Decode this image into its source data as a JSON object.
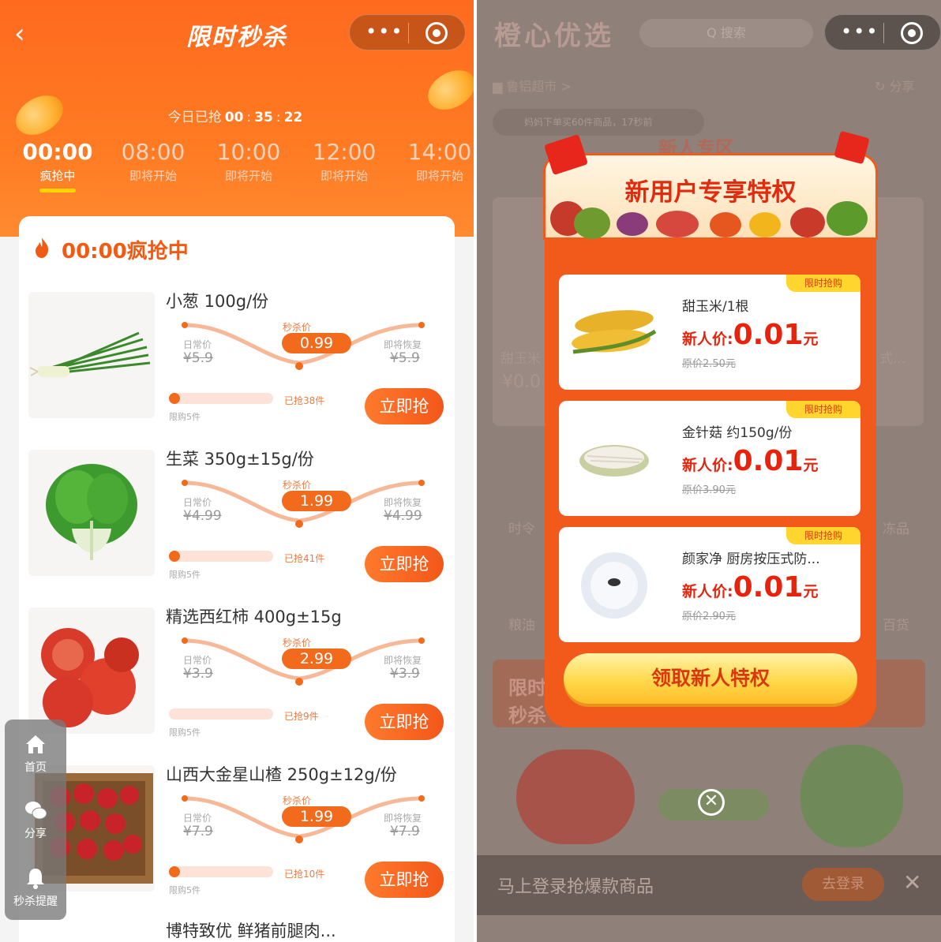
{
  "left": {
    "title": "限时秒杀",
    "capsule": {
      "more": "•••"
    },
    "countdown": {
      "prefix": "今日已抢",
      "h": "00",
      "m": "35",
      "s": "22",
      "sep": ":"
    },
    "tabs": [
      {
        "time": "00:00",
        "status": "疯抢中",
        "active": true
      },
      {
        "time": "08:00",
        "status": "即将开始"
      },
      {
        "time": "10:00",
        "status": "即将开始"
      },
      {
        "time": "12:00",
        "status": "即将开始"
      },
      {
        "time": "14:00",
        "status": "即将开始"
      }
    ],
    "section_title": "00:00疯抢中",
    "labels": {
      "daily": "日常价",
      "seckill": "秒杀价",
      "restore": "即将恢复",
      "buy": "立即抢"
    },
    "products": [
      {
        "name": "小葱 100g/份",
        "daily": "¥5.9",
        "seckill": "0.99",
        "restore": "¥5.9",
        "sold": "已抢38件",
        "limit": "限购5件",
        "progress": 0.05
      },
      {
        "name": "生菜 350g±15g/份",
        "daily": "¥4.99",
        "seckill": "1.99",
        "restore": "¥4.99",
        "sold": "已抢41件",
        "limit": "限购5件",
        "progress": 0.05
      },
      {
        "name": "精选西红柿 400g±15g",
        "daily": "¥3.9",
        "seckill": "2.99",
        "restore": "¥3.9",
        "sold": "已抢9件",
        "limit": "限购5件",
        "progress": 0.0
      },
      {
        "name": "山西大金星山楂 250g±12g/份",
        "daily": "¥7.9",
        "seckill": "1.99",
        "restore": "¥7.9",
        "sold": "已抢10件",
        "limit": "限购5件",
        "progress": 0.05
      }
    ],
    "last_item": "博特致优 鲜猪前腿肉...",
    "float_menu": [
      {
        "label": "首页",
        "icon": "home-icon"
      },
      {
        "label": "分享",
        "icon": "wechat-icon"
      },
      {
        "label": "秒杀提醒",
        "icon": "bell-icon"
      }
    ]
  },
  "right": {
    "app_title": "橙心优选",
    "search": "Q 搜索",
    "store": "鲁铝超市 >",
    "share": "分享",
    "notice": "妈妈下单买60件商品，17秒前",
    "ghost_banner": "新人专区",
    "ghost_left_texts": [
      "甜玉米",
      "¥0.0",
      "时令",
      "粮油"
    ],
    "ghost_right_texts": [
      "式...",
      "冻品",
      "百货"
    ],
    "ghost_seckill": "限时秒杀",
    "popup": {
      "title": "新用户专享特权",
      "tag": "限时抢购",
      "new_price_label": "新人价:",
      "yuan": "元",
      "items": [
        {
          "name": "甜玉米/1根",
          "price": "0.01",
          "orig": "原价2.50元"
        },
        {
          "name": "金针菇 约150g/份",
          "price": "0.01",
          "orig": "原价3.90元"
        },
        {
          "name": "颜家净 厨房按压式防...",
          "price": "0.01",
          "orig": "原价2.90元"
        }
      ],
      "claim": "领取新人特权",
      "close": "✕"
    },
    "login_bar": {
      "text": "马上登录抢爆款商品",
      "btn": "去登录",
      "close": "✕"
    }
  }
}
